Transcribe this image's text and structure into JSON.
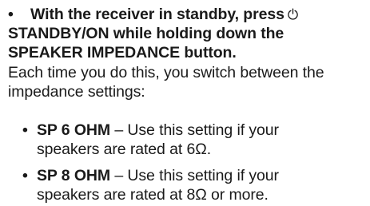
{
  "step": {
    "bullet": "•",
    "line1_before_icon": "With the receiver in standby, press",
    "power_icon": "power-icon",
    "line2": "STANDBY/ON while holding down the",
    "line3": "SPEAKER IMPEDANCE button."
  },
  "description": {
    "line1": "Each time you do this, you switch between the",
    "line2": "impedance settings:"
  },
  "options": [
    {
      "bullet": "•",
      "name": "SP 6 OHM",
      "text_line1": " – Use this setting if your",
      "text_line2": "speakers are rated at 6Ω."
    },
    {
      "bullet": "•",
      "name": "SP 8 OHM",
      "text_line1": " – Use this setting if your",
      "text_line2": "speakers are rated at 8Ω or more."
    }
  ]
}
